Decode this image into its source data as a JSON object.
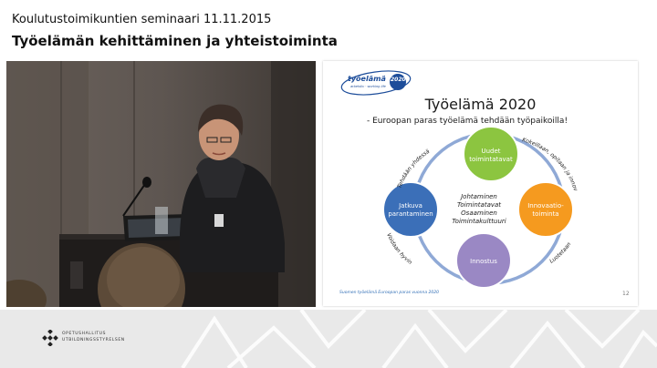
{
  "header": {
    "line1": "Koulutustoimikuntien seminaari 11.11.2015",
    "line2": "Työelämän kehittäminen ja yhteistoiminta"
  },
  "slide": {
    "logo": {
      "line1": "työelämä",
      "year": "2020",
      "small": "arbetsliv · working life"
    },
    "title": "Työelämä 2020",
    "subtitle": "- Euroopan paras työelämä tehdään työpaikoilla!",
    "circles": {
      "top": [
        "Uudet",
        "toimintatavat"
      ],
      "right": [
        "Innovaatio-",
        "toiminta"
      ],
      "bottom": [
        "Innostus"
      ],
      "left": [
        "Jatkuva",
        "parantaminen"
      ]
    },
    "center": [
      "Johtaminen",
      "Toimintatavat",
      "Osaaminen",
      "Toimintakulttuuri"
    ],
    "arc_labels": {
      "top_left": "Tehdään yhdessä",
      "top_right": "Kokeillaan, opitaan ja innovoidaan",
      "bottom_right": "Luotetaan",
      "bottom_left": "Voidaan hyvin"
    },
    "footer": "Suomen työelämä Euroopan paras vuonna 2020",
    "page": "12",
    "colors": {
      "green": "#8cc540",
      "orange": "#f59a1f",
      "purple": "#9a88c4",
      "blue": "#3b6fb8"
    }
  },
  "footer": {
    "org_line1": "OPETUSHALLITUS",
    "org_line2": "UTBILDNINGSSTYRELSEN"
  }
}
